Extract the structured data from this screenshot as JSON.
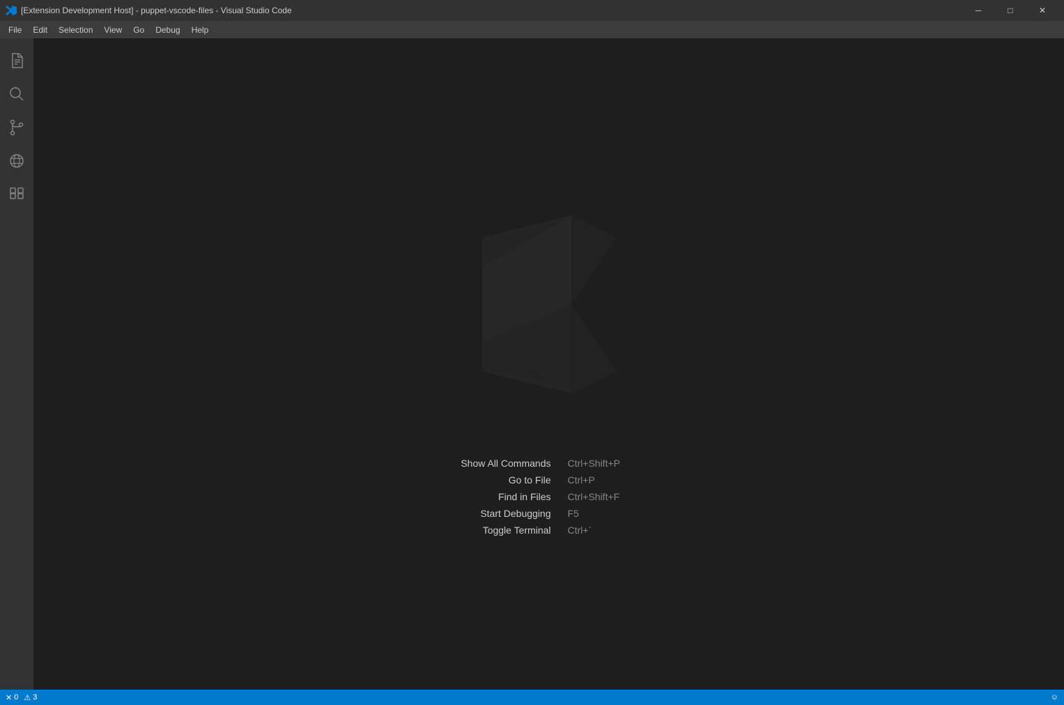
{
  "titlebar": {
    "icon_color": "#0078d4",
    "title": "[Extension Development Host] - puppet-vscode-files - Visual Studio Code",
    "minimize_label": "─",
    "maximize_label": "□",
    "close_label": "✕"
  },
  "menubar": {
    "items": [
      {
        "label": "File"
      },
      {
        "label": "Edit"
      },
      {
        "label": "Selection"
      },
      {
        "label": "View"
      },
      {
        "label": "Go"
      },
      {
        "label": "Debug"
      },
      {
        "label": "Help"
      }
    ]
  },
  "activity_bar": {
    "icons": [
      {
        "name": "files-icon",
        "symbol": "⎘"
      },
      {
        "name": "search-icon",
        "symbol": "🔍"
      },
      {
        "name": "source-control-icon",
        "symbol": "⑂"
      },
      {
        "name": "extensions-icon",
        "symbol": "⊞"
      },
      {
        "name": "debug-icon",
        "symbol": "⊗"
      }
    ]
  },
  "shortcuts": [
    {
      "label": "Show All Commands",
      "key": "Ctrl+Shift+P"
    },
    {
      "label": "Go to File",
      "key": "Ctrl+P"
    },
    {
      "label": "Find in Files",
      "key": "Ctrl+Shift+F"
    },
    {
      "label": "Start Debugging",
      "key": "F5"
    },
    {
      "label": "Toggle Terminal",
      "key": "Ctrl+`"
    }
  ],
  "statusbar": {
    "errors": "0",
    "warnings": "3",
    "error_icon": "✕",
    "warning_icon": "⚠",
    "smiley": "☺"
  }
}
